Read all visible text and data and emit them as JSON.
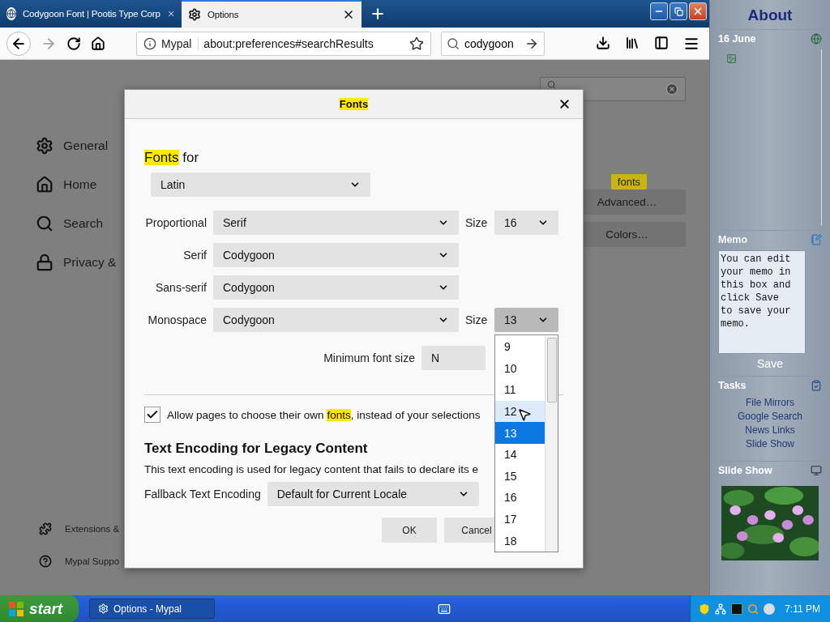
{
  "browser": {
    "tabs": [
      {
        "title": "Codygoon Font | Pootis Type Corp",
        "selected": false
      },
      {
        "title": "Options",
        "selected": true
      }
    ],
    "address_bar": {
      "site": "Mypal",
      "url": "about:preferences#searchResults"
    },
    "search_bar": {
      "value": "codygoon"
    }
  },
  "preferences": {
    "nav": [
      {
        "label": "General",
        "kind": "gear"
      },
      {
        "label": "Home",
        "kind": "home"
      },
      {
        "label": "Search",
        "kind": "search"
      },
      {
        "label": "Privacy &",
        "kind": "lock"
      }
    ],
    "footer_nav": [
      {
        "label": "Extensions &",
        "kind": "puzzle"
      },
      {
        "label": "Mypal Suppo",
        "kind": "help"
      }
    ],
    "search_tooltip": "fonts",
    "buttons": [
      {
        "label": "Advanced…"
      },
      {
        "label": "Colors…"
      }
    ]
  },
  "dialog": {
    "title": "Fonts",
    "heading": [
      {
        "text": "Fonts",
        "highlight": true
      },
      {
        "text": " for",
        "highlight": false
      }
    ],
    "language": "Latin",
    "font_rows": [
      {
        "label": "Proportional",
        "value": "Serif",
        "size_label": "Size",
        "size": "16",
        "size_open": false
      },
      {
        "label": "Serif",
        "value": "Codygoon"
      },
      {
        "label": "Sans-serif",
        "value": "Codygoon"
      },
      {
        "label": "Monospace",
        "value": "Codygoon",
        "size_label": "Size",
        "size": "13",
        "size_open": true
      }
    ],
    "minimum_size": {
      "label": "Minimum font size",
      "value": "N"
    },
    "allow_checkbox": {
      "checked": true,
      "parts": [
        {
          "text": "Allow pages to choose their own ",
          "highlight": false
        },
        {
          "text": "fonts",
          "highlight": true
        },
        {
          "text": ", instead of your selections",
          "highlight": false
        }
      ]
    },
    "encoding_heading": "Text Encoding for Legacy Content",
    "encoding_description": "This text encoding is used for legacy content that fails to declare its e",
    "fallback": {
      "label": "Fallback Text Encoding",
      "value": "Default for Current Locale"
    },
    "buttons": [
      "OK",
      "Cancel"
    ]
  },
  "size_dropdown": {
    "options": [
      {
        "label": "9",
        "selected": false,
        "hovered": false
      },
      {
        "label": "10",
        "selected": false,
        "hovered": false
      },
      {
        "label": "11",
        "selected": false,
        "hovered": false
      },
      {
        "label": "12",
        "selected": false,
        "hovered": true
      },
      {
        "label": "13",
        "selected": true,
        "hovered": false
      },
      {
        "label": "14",
        "selected": false,
        "hovered": false
      },
      {
        "label": "15",
        "selected": false,
        "hovered": false
      },
      {
        "label": "16",
        "selected": false,
        "hovered": false
      },
      {
        "label": "17",
        "selected": false,
        "hovered": false
      },
      {
        "label": "18",
        "selected": false,
        "hovered": false
      }
    ]
  },
  "about_panel": {
    "title": "About",
    "date": "16 June",
    "memo": {
      "title": "Memo",
      "text": "You can edit your memo in this box and click Save to save your memo.",
      "save": "Save"
    },
    "tasks": {
      "title": "Tasks",
      "links": [
        "File Mirrors",
        "Google Search",
        "News Links",
        "Slide Show"
      ]
    },
    "slideshow": {
      "title": "Slide Show"
    }
  },
  "taskbar": {
    "start": "start",
    "tasks": [
      "Options - Mypal"
    ],
    "clock": "7:11 PM"
  }
}
